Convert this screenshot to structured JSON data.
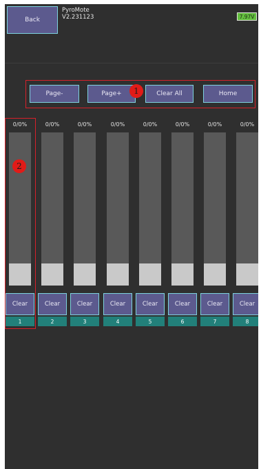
{
  "header": {
    "back_label": "Back",
    "app_name": "PyroMote",
    "version": "V2.231123",
    "battery": "7.97V"
  },
  "nav": {
    "page_prev": "Page-",
    "page_next": "Page+",
    "clear_all": "Clear All",
    "home": "Home"
  },
  "annotations": {
    "marker1": "1",
    "marker2": "2"
  },
  "channels": [
    {
      "number": "1",
      "value_text": "0/0%",
      "clear_label": "Clear",
      "level": 0
    },
    {
      "number": "2",
      "value_text": "0/0%",
      "clear_label": "Clear",
      "level": 0
    },
    {
      "number": "3",
      "value_text": "0/0%",
      "clear_label": "Clear",
      "level": 0
    },
    {
      "number": "4",
      "value_text": "0/0%",
      "clear_label": "Clear",
      "level": 0
    },
    {
      "number": "5",
      "value_text": "0/0%",
      "clear_label": "Clear",
      "level": 0
    },
    {
      "number": "6",
      "value_text": "0/0%",
      "clear_label": "Clear",
      "level": 0
    },
    {
      "number": "7",
      "value_text": "0/0%",
      "clear_label": "Clear",
      "level": 0
    },
    {
      "number": "8",
      "value_text": "0/0%",
      "clear_label": "Clear",
      "level": 0
    }
  ],
  "colors": {
    "background": "#2f2f2f",
    "button_fill": "#5c5a8e",
    "button_border": "#7ed3df",
    "channel_number_fill": "#22807a",
    "battery_fill": "#63bf3e",
    "annotation_red": "#d8212a"
  }
}
